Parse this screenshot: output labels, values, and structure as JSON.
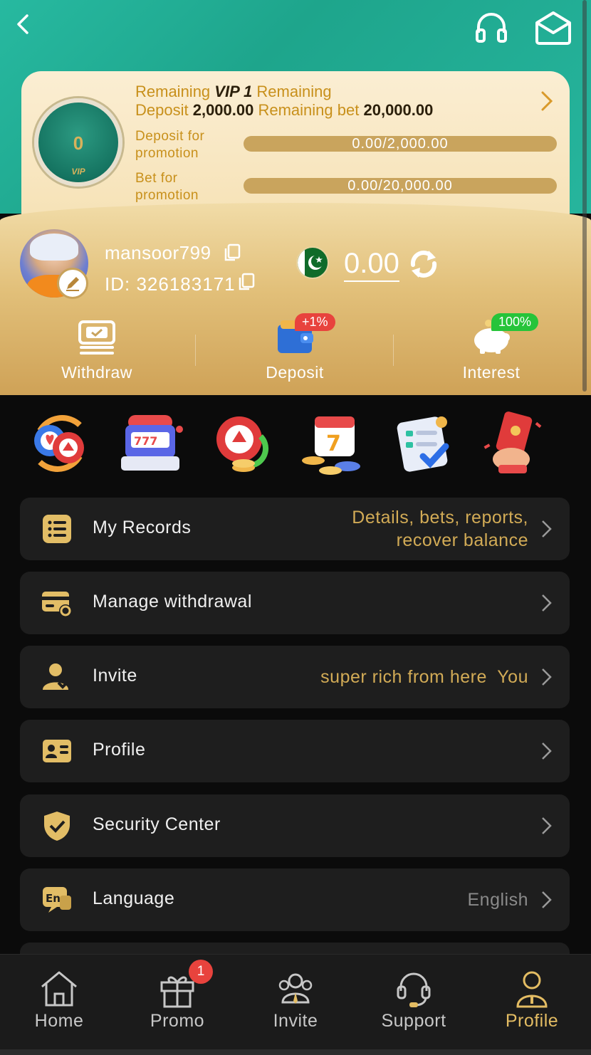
{
  "vip": {
    "level_badge": "0",
    "badge_label": "VIP",
    "line1_prefix": "Remaining",
    "line1_vip": "VIP 1",
    "line1_suffix": "Remaining",
    "line2_deposit_label": "Deposit",
    "line2_deposit_value": "2,000.00",
    "line2_bet_label": "Remaining bet",
    "line2_bet_value": "20,000.00",
    "deposit_promo_label": "Deposit for promotion",
    "deposit_progress": "0.00/2,000.00",
    "bet_promo_label": "Bet for promotion",
    "bet_progress": "0.00/20,000.00"
  },
  "user": {
    "username": "mansoor799",
    "id_label": "ID:",
    "id_value": "326183171",
    "balance": "0.00"
  },
  "actions": {
    "withdraw": "Withdraw",
    "deposit": "Deposit",
    "deposit_tag": "+1%",
    "interest": "Interest",
    "interest_tag": "100%"
  },
  "quick_icons": [
    "poker-chips-swap-icon",
    "slot-machine-icon",
    "chip-refresh-icon",
    "calendar-lucky7-icon",
    "checklist-icon",
    "red-envelope-icon"
  ],
  "menu": [
    {
      "label": "My Records",
      "hint": "Details, bets, reports,\nrecover balance"
    },
    {
      "label": "Manage withdrawal",
      "hint": ""
    },
    {
      "label": "Invite",
      "hint": "super rich from here  You"
    },
    {
      "label": "Profile",
      "hint": ""
    },
    {
      "label": "Security Center",
      "hint": ""
    },
    {
      "label": "Language",
      "hint": "English"
    }
  ],
  "nav": {
    "home": "Home",
    "promo": "Promo",
    "promo_badge": "1",
    "invite": "Invite",
    "support": "Support",
    "profile": "Profile"
  },
  "colors": {
    "teal": "#26b59d",
    "gold": "#e2c07a",
    "accent_text": "#d2ab56",
    "dark_bg": "#0b0b0b",
    "card_bg": "#1e1e1e"
  }
}
